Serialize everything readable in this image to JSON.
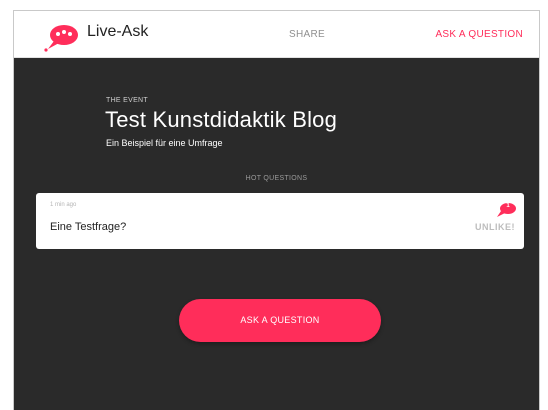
{
  "app": {
    "name": "Live-Ask",
    "brand_color": "#ff2d5a"
  },
  "nav": {
    "share_label": "SHARE",
    "ask_label": "ASK A QUESTION"
  },
  "event": {
    "overline": "THE EVENT",
    "title": "Test Kunstdidaktik Blog",
    "subtitle": "Ein Beispiel für eine Umfrage"
  },
  "hot_questions": {
    "label": "HOT QUESTIONS",
    "items": [
      {
        "time": "1 min ago",
        "text": "Eine Testfrage?",
        "votes": "1",
        "action_label": "UNLIKE!"
      }
    ]
  },
  "cta": {
    "ask_label": "ASK A QUESTION"
  },
  "icons": {
    "logo": "speech-bubble-icon",
    "vote": "speech-bubble-icon"
  }
}
